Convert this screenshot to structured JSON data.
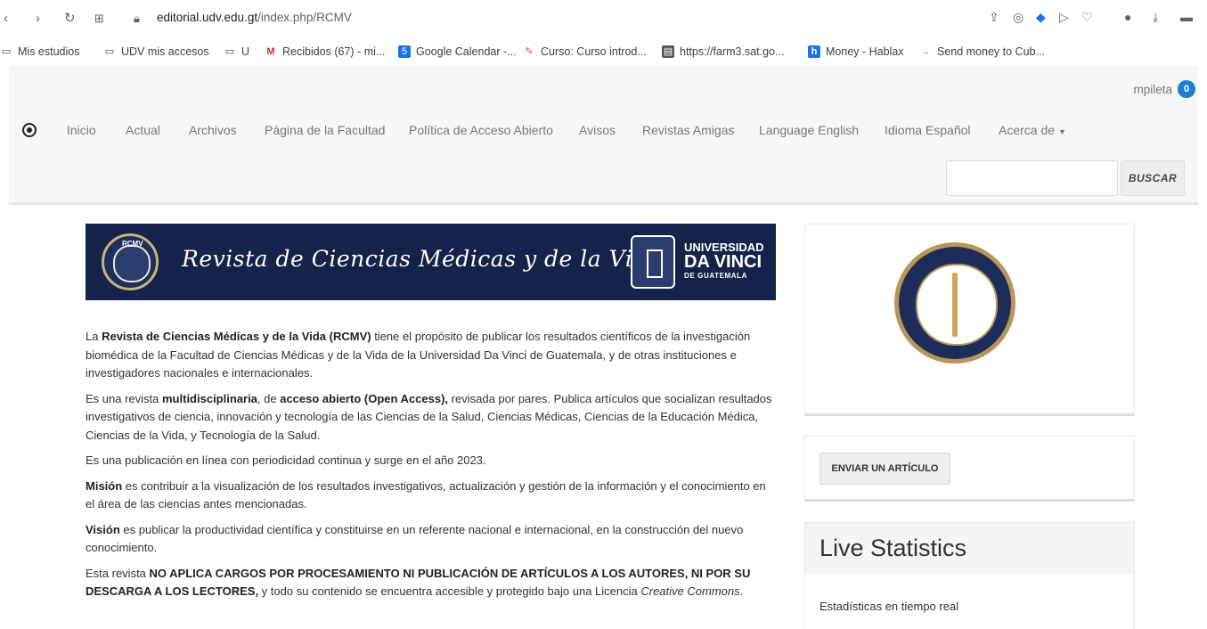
{
  "browser": {
    "url_host": "editorial.udv.edu.gt",
    "url_path": "/index.php/RCMV",
    "bookmarks": [
      "Mis estudios",
      "UDV mis accesos",
      "U",
      "Recibidos (67) - mi...",
      "Google Calendar -...",
      "Curso: Curso introd...",
      "https://farm3.sat.go...",
      "Money - Hablax",
      "Send money to Cub..."
    ],
    "bookmark_icons": [
      "folder-icon",
      "folder-icon",
      "folder-icon",
      "gmail-icon",
      "calendar-icon",
      "course-icon",
      "page-icon",
      "hablax-icon",
      "arrow-icon"
    ]
  },
  "header": {
    "username": "mpileta",
    "notification_count": "0",
    "nav": [
      "Inicio",
      "Actual",
      "Archivos",
      "Página de la Facultad",
      "Política de Acceso Abierto",
      "Avisos",
      "Revistas Amigas",
      "Language English",
      "Idioma Español",
      "Acerca de"
    ],
    "search_button": "BUSCAR",
    "search_value": ""
  },
  "banner": {
    "seal_label": "RCMV",
    "title": "Revista de Ciencias Médicas y de la Vida",
    "uni_l1": "UNIVERSIDAD",
    "uni_l2": "DA VINCI",
    "uni_l3": "DE GUATEMALA"
  },
  "content": {
    "p1_a": "La ",
    "p1_b": "Revista de Ciencias Médicas y de la Vida (RCMV)",
    "p1_c": " tiene el propósito de publicar los resultados científicos de la investigación biomédica de la Facultad de Ciencias Médicas y de la Vida de la Universidad Da Vinci de Guatemala, y de otras instituciones e investigadores nacionales e internacionales.",
    "p2_a": "Es una revista ",
    "p2_b": "multidisciplinaria",
    "p2_c": ", de ",
    "p2_d": "acceso abierto (Open Access),",
    "p2_e": " revisada por pares. Publica artículos que socializan resultados investigativos de ciencia, innovación y tecnología de las Ciencias de la Salud, Ciencias Médicas, Ciencias de la Educación Médica, Ciencias de la Vida, y Tecnología de la Salud.",
    "p3": "Es una publicación en línea con periodicidad continua y surge en el año 2023.",
    "p4_a": "Misión",
    "p4_b": " es contribuir a la visualización de los resultados investigativos, actualización y gestión de la información y el conocimiento en el área de las ciencias antes mencionadas.",
    "p5_a": "Visión",
    "p5_b": " es publicar la productividad científica y constituirse en un referente nacional e internacional, en la construcción del nuevo conocimiento.",
    "p6_a": "Esta revista ",
    "p6_b": "NO APLICA CARGOS POR PROCESAMIENTO NI PUBLICACIÓN DE ARTÍCULOS A LOS AUTORES, NI POR SU DESCARGA A LOS LECTORES,",
    "p6_c": " y todo su contenido se encuentra accesible y protegido bajo una Licencia ",
    "p6_d": "Creative Commons",
    "p6_e": "."
  },
  "sidebar": {
    "submit_button": "ENVIAR UN ARTÍCULO",
    "stats_title": "Live Statistics",
    "stats_text": "Estadísticas en tiempo real"
  },
  "colors": {
    "banner_bg": "#15234a",
    "accent_badge": "#1b7fd1",
    "seal_gold": "#b8965a"
  }
}
